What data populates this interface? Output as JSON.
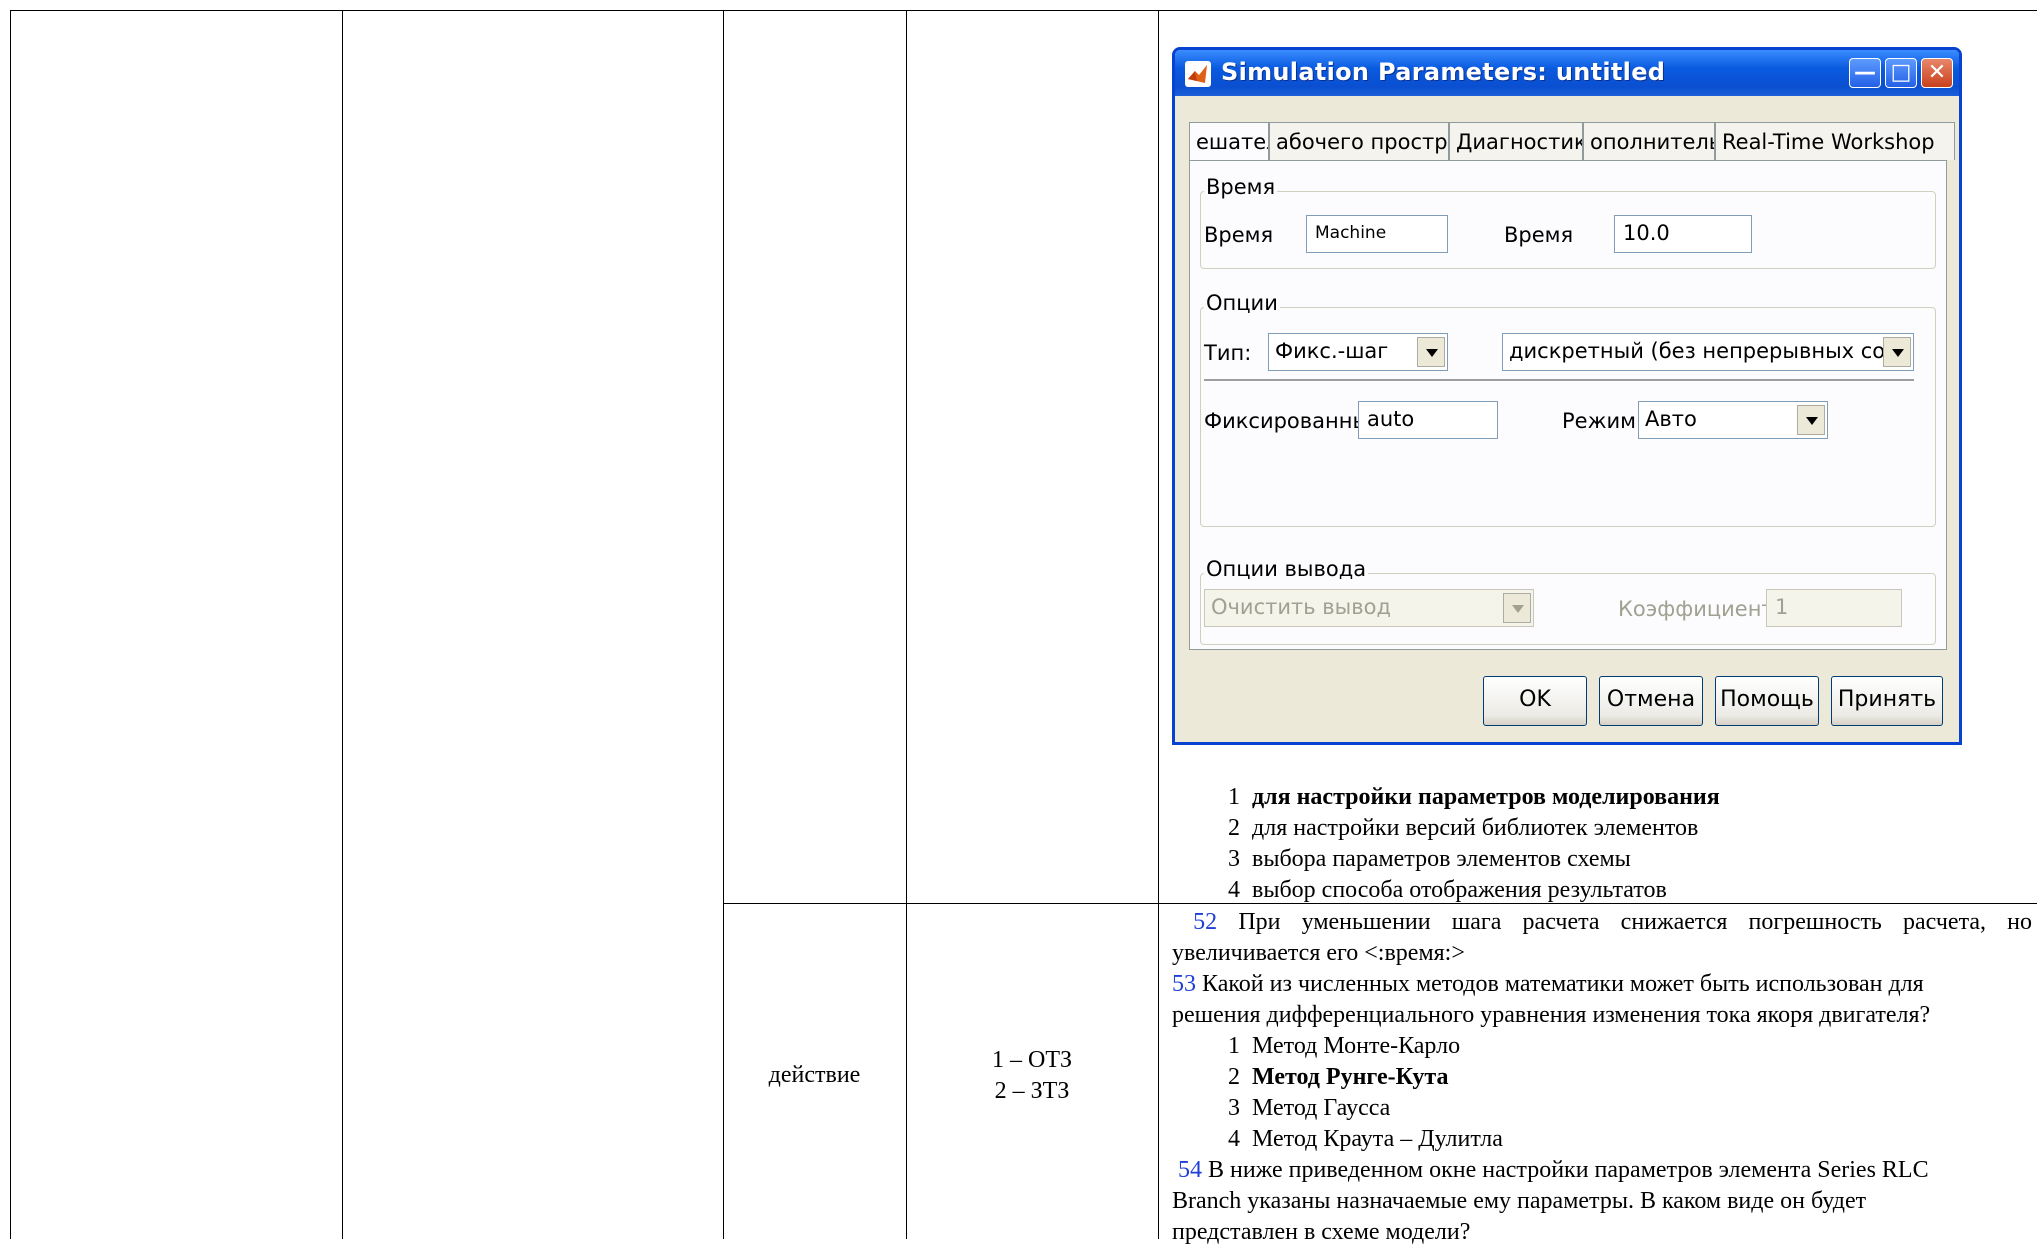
{
  "table": {
    "col3_label": "действие",
    "col4_lines": [
      "1 – ОТЗ",
      "2 – ЗТЗ"
    ]
  },
  "dialog": {
    "title": "Simulation Parameters: untitled",
    "tabs": [
      "ешател",
      "абочего простра",
      "Диагностика",
      "ополнитель",
      "Real-Time Workshop"
    ],
    "group_time": "Время",
    "start_label": "Время",
    "start_value": "Machine",
    "stop_label": "Время",
    "stop_value": "10.0",
    "group_options": "Опции",
    "type_label": "Тип:",
    "type_value": "Фикс.-шаг",
    "solver_value": "дискретный (без непрерывных сос",
    "fixed_label": "Фиксированнь",
    "fixed_value": "auto",
    "mode_label": "Режим:",
    "mode_value": "Авто",
    "group_output": "Опции вывода",
    "output_value": "Очистить вывод",
    "coef_label": "Коэффициент",
    "coef_value": "1",
    "buttons": {
      "ok": "OK",
      "cancel": "Отмена",
      "help": "Помощь",
      "apply": "Принять"
    }
  },
  "answers_q51": [
    {
      "n": "1",
      "text": "для настройки параметров моделирования",
      "bold": true
    },
    {
      "n": "2",
      "text": "для настройки версий библиотек элементов",
      "bold": false
    },
    {
      "n": "3",
      "text": "выбора параметров элементов схемы",
      "bold": false
    },
    {
      "n": "4",
      "text": "выбор способа отображения результатов",
      "bold": false
    }
  ],
  "q52": {
    "num": "52",
    "line1": "При уменьшении шага расчета снижается погрешность расчета, но",
    "line2": "увеличивается его  <:время:>"
  },
  "q53": {
    "num": "53",
    "line1": "Какой из численных методов математики может быть использован для",
    "line2": "решения дифференциального уравнения изменения тока якоря двигателя?",
    "answers": [
      {
        "n": "1",
        "text": "Метод Монте-Карло",
        "bold": false
      },
      {
        "n": "2",
        "text": "Метод Рунге-Кута",
        "bold": true
      },
      {
        "n": "3",
        "text": "Метод Гаусса",
        "bold": false
      },
      {
        "n": "4",
        "text": "Метод Краута – Дулитла",
        "bold": false
      }
    ]
  },
  "q54": {
    "num": "54",
    "line1": "В ниже приведенном окне настройки параметров элемента Series RLC",
    "line2": "Branch указаны назначаемые ему параметры. В каком виде он будет",
    "line3": "представлен в схеме модели?"
  }
}
